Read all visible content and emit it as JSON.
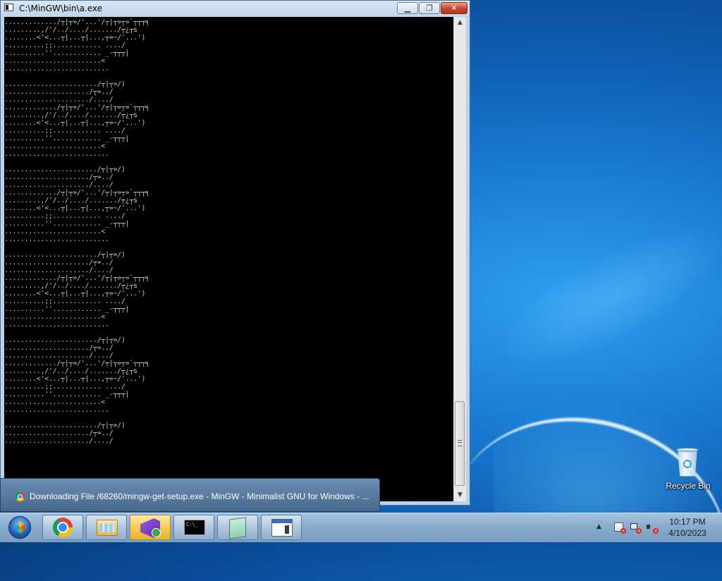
{
  "window": {
    "title": "C:\\MinGW\\bin\\a.exe",
    "controls": {
      "minimize": "▁",
      "maximize": "❐",
      "close": "✕"
    }
  },
  "console": {
    "lines": [
      "............./┬|┬»/'...'/┬|┬»┬»`┬┬┬╕",
      ".........,/'/../..../......./┬¿┬s",
      "........<'<...┬|...┬|...,┬»~/'...')",
      "..........;;............ ..../",
      "..........''............ _-┬┬┬|",
      "........................<",
      "..........................",
      "",
      "......................./┬|┬»/)",
      "...................../┬»../",
      "...................../..../",
      "............./┬|┬»/'...'/┬|┬»┬»`┬┬┬╕",
      ".........,/'/../..../......./┬¿┬s",
      "........<'<...┬|...┬|...,┬»~/'...')",
      "..........;;............ ..../",
      "..........''............ _-┬┬┬|",
      "........................<",
      "..........................",
      "",
      "......................./┬|┬»/)",
      "...................../┬»../",
      "...................../..../",
      "............./┬|┬»/'...'/┬|┬»┬»`┬┬┬╕",
      ".........,/'/../..../......./┬¿┬s",
      "........<'<...┬|...┬|...,┬»~/'...')",
      "..........;;............ ..../",
      "..........''............ _-┬┬┬|",
      "........................<",
      "..........................",
      "",
      "......................./┬|┬»/)",
      "...................../┬»../",
      "...................../..../",
      "............./┬|┬»/'...'/┬|┬»┬»`┬┬┬╕",
      ".........,/'/../..../......./┬¿┬s",
      "........<'<...┬|...┬|...,┬»~/'...')",
      "..........;;............ ..../",
      "..........''............ _-┬┬┬|",
      "........................<",
      "..........................",
      "",
      "......................./┬|┬»/)",
      "...................../┬»../",
      "...................../..../",
      "............./┬|┬»/'...'/┬|┬»┬»`┬┬┬╕",
      ".........,/'/../..../......./┬¿┬s",
      "........<'<...┬|...┬|...,┬»~/'...')",
      "..........;;............ ..../",
      "..........''............ _-┬┬┬|",
      "........................<",
      "..........................",
      "",
      "......................./┬|┬»/)",
      "...................../┬»../",
      "...................../..../"
    ]
  },
  "scrollbar": {
    "up_arrow": "▲",
    "down_arrow": "▼"
  },
  "download_popup": {
    "icon": "chrome-icon",
    "text": "Downloading File /68260/mingw-get-setup.exe - MinGW - Minimalist GNU for Windows - ..."
  },
  "taskbar": {
    "start_icon": "windows-orb-icon",
    "buttons": [
      {
        "icon": "chrome-icon",
        "active": false
      },
      {
        "icon": "explorer-folder-icon",
        "active": false
      },
      {
        "icon": "visual-studio-icon",
        "active": true
      },
      {
        "icon": "command-prompt-icon",
        "active": false
      },
      {
        "icon": "notepad-icon",
        "active": false
      },
      {
        "icon": "application-window-icon",
        "active": false
      }
    ],
    "tray": {
      "show_hidden": "▲",
      "icons": [
        "action-center-icon",
        "network-icon",
        "volume-icon"
      ],
      "clock_time": "10:17 PM",
      "clock_date": "4/10/2023"
    }
  },
  "desktop": {
    "icons": [
      {
        "icon": "recycle-bin-icon",
        "label": "Recycle Bin"
      }
    ]
  },
  "colors": {
    "desktop_blue": "#1b7fd6",
    "console_bg": "#000000",
    "console_text": "#c8c8c8",
    "close_red": "#c7432c",
    "active_taskbar": "#f5c94c"
  }
}
